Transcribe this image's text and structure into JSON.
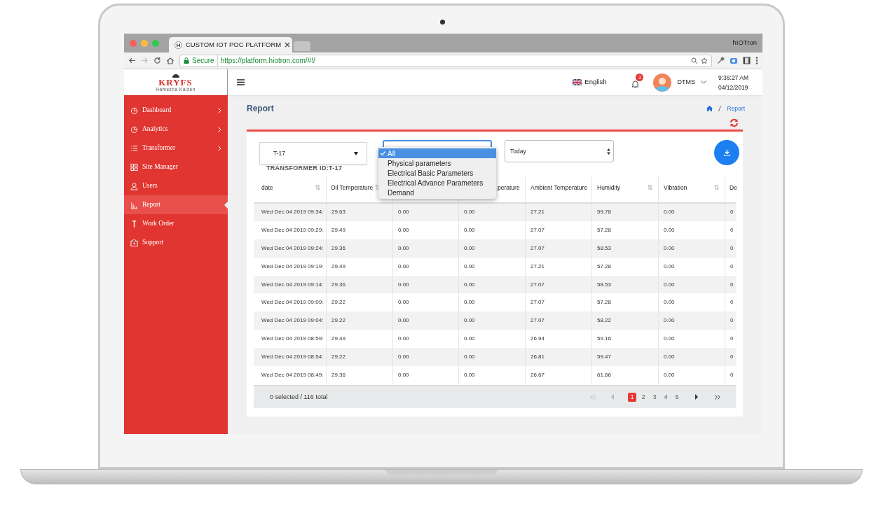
{
  "browser": {
    "tab_title": "CUSTOM IOT POC PLATFORM",
    "profile": "hIOTron",
    "secure_label": "Secure",
    "url": "https://platform.hiotron.com/#!/"
  },
  "header": {
    "logo": "KRYFS",
    "logo_tagline": "Hamesha Kaizen",
    "language": "English",
    "notification_count": "3",
    "user": "DTMS",
    "time": "9:36:27 AM",
    "date": "04/12/2019"
  },
  "sidebar": {
    "items": [
      {
        "label": "Dashboard",
        "kind": "pie",
        "has_submenu": true,
        "selected": false
      },
      {
        "label": "Analytics",
        "kind": "pie",
        "has_submenu": true,
        "selected": false
      },
      {
        "label": "Transformer",
        "kind": "list",
        "has_submenu": true,
        "selected": false
      },
      {
        "label": "Site Manager",
        "kind": "grid",
        "has_submenu": false,
        "selected": false
      },
      {
        "label": "Users",
        "kind": "user",
        "has_submenu": false,
        "selected": false
      },
      {
        "label": "Report",
        "kind": "chart",
        "has_submenu": false,
        "selected": true
      },
      {
        "label": "Work Order",
        "kind": "tool",
        "has_submenu": false,
        "selected": false
      },
      {
        "label": "Support",
        "kind": "box",
        "has_submenu": false,
        "selected": false
      }
    ]
  },
  "page": {
    "title": "Report",
    "breadcrumb_current": "Report"
  },
  "filters": {
    "transformer_select": "T-17",
    "transformer_id": "TRANSFORMER ID:T-17",
    "period_select": "Today",
    "parameter_dropdown": {
      "expanded": true,
      "options": [
        {
          "label": "All",
          "selected": true
        },
        {
          "label": "Physical parameters",
          "selected": false
        },
        {
          "label": "Electrical Basic Parameters",
          "selected": false
        },
        {
          "label": "Electrical Advance Parameters",
          "selected": false
        },
        {
          "label": "Demand",
          "selected": false
        }
      ]
    }
  },
  "table": {
    "columns": [
      {
        "label": "date",
        "sort_icon": true
      },
      {
        "label": "Oil Temperature",
        "sort_icon": true
      },
      {},
      {
        "label": "perature",
        "sort_icon": false
      },
      {
        "label": "Ambient Temperature",
        "sort_icon": false
      },
      {
        "label": "Humidity",
        "sort_icon": true
      },
      {
        "label": "Vibration",
        "sort_icon": true
      },
      {
        "label": "De"
      }
    ],
    "rows": [
      [
        "Wed Dec 04 2019 09:34:",
        "29.63",
        "0.00",
        "0.00",
        "27.21",
        "59.78",
        "0.00",
        "0"
      ],
      [
        "Wed Dec 04 2019 09:29:",
        "29.49",
        "0.00",
        "0.00",
        "27.07",
        "57.28",
        "0.00",
        "0"
      ],
      [
        "Wed Dec 04 2019 09:24:",
        "29.36",
        "0.00",
        "0.00",
        "27.07",
        "58.53",
        "0.00",
        "0"
      ],
      [
        "Wed Dec 04 2019 09:19:",
        "29.49",
        "0.00",
        "0.00",
        "27.21",
        "57.28",
        "0.00",
        "0"
      ],
      [
        "Wed Dec 04 2019 09:14:",
        "29.36",
        "0.00",
        "0.00",
        "27.07",
        "58.53",
        "0.00",
        "0"
      ],
      [
        "Wed Dec 04 2019 09:09:",
        "29.22",
        "0.00",
        "0.00",
        "27.07",
        "57.28",
        "0.00",
        "0"
      ],
      [
        "Wed Dec 04 2019 09:04:",
        "29.22",
        "0.00",
        "0.00",
        "27.07",
        "58.22",
        "0.00",
        "0"
      ],
      [
        "Wed Dec 04 2019 08:59:",
        "29.49",
        "0.00",
        "0.00",
        "26.94",
        "59.16",
        "0.00",
        "0"
      ],
      [
        "Wed Dec 04 2019 08:54:",
        "29.22",
        "0.00",
        "0.00",
        "26.81",
        "59.47",
        "0.00",
        "0"
      ],
      [
        "Wed Dec 04 2019 08:49:",
        "29.36",
        "0.00",
        "0.00",
        "26.67",
        "61.66",
        "0.00",
        "0"
      ]
    ],
    "selection_summary": "0 selected / 116 total"
  },
  "pagination": {
    "back_disabled": true,
    "forward_disabled": false,
    "pages": [
      {
        "label": "1",
        "selected": true
      },
      {
        "label": "2",
        "selected": false
      },
      {
        "label": "3",
        "selected": false
      },
      {
        "label": "4",
        "selected": false
      },
      {
        "label": "5",
        "selected": false
      }
    ]
  }
}
